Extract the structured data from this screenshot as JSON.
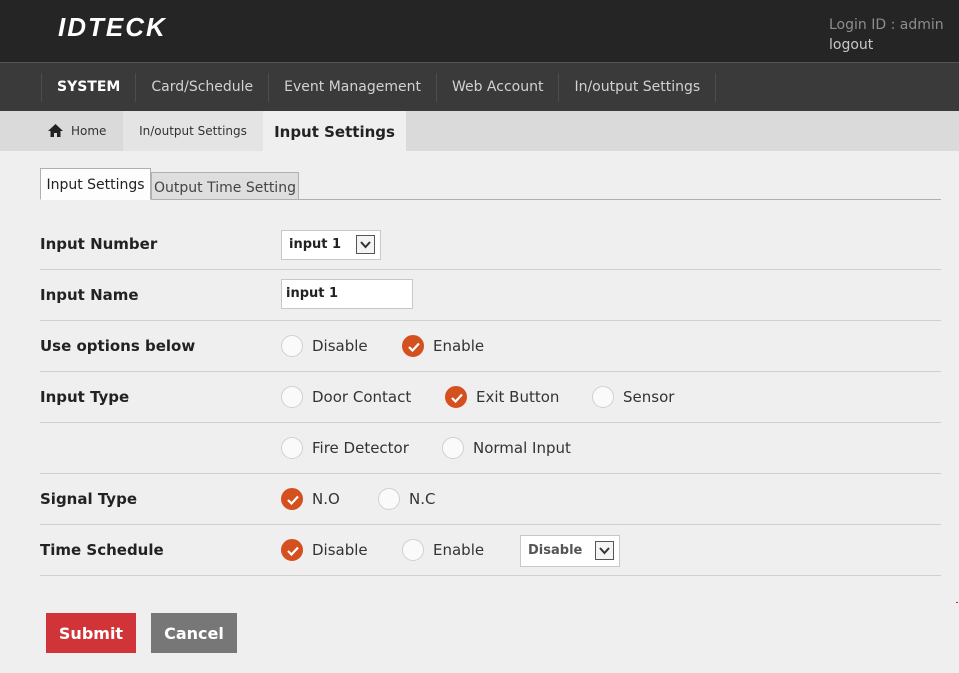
{
  "header": {
    "logo": "IDTECK",
    "login_id": "Login ID : admin",
    "logout": "logout"
  },
  "nav": {
    "items": [
      "SYSTEM",
      "Card/Schedule",
      "Event Management",
      "Web Account",
      "In/output Settings"
    ],
    "active": "SYSTEM"
  },
  "breadcrumb": {
    "home": "Home",
    "section": "In/output Settings",
    "current": "Input Settings"
  },
  "tabs": {
    "active": "Input Settings",
    "other": "Output Time Setting"
  },
  "form": {
    "input_number": {
      "label": "Input Number",
      "value": "input 1"
    },
    "input_name": {
      "label": "Input Name",
      "value": "input 1"
    },
    "use_options": {
      "label": "Use options below",
      "options": [
        "Disable",
        "Enable"
      ],
      "selected": "Enable"
    },
    "input_type": {
      "label": "Input Type",
      "options": [
        "Door Contact",
        "Exit Button",
        "Sensor",
        "Fire Detector",
        "Normal Input"
      ],
      "selected": "Exit Button"
    },
    "signal_type": {
      "label": "Signal Type",
      "options": [
        "N.O",
        "N.C"
      ],
      "selected": "N.O"
    },
    "time_schedule": {
      "label": "Time Schedule",
      "options": [
        "Disable",
        "Enable"
      ],
      "selected": "Disable",
      "select_value": "Disable"
    }
  },
  "buttons": {
    "submit": "Submit",
    "cancel": "Cancel"
  },
  "colors": {
    "accent": "#d5501f",
    "submit": "#d03438",
    "cancel": "#777777",
    "header": "#252525",
    "nav": "#3a3a3a"
  },
  "icons": {
    "home": "home-icon",
    "dropdown": "chevron-down-icon",
    "check": "check-icon"
  }
}
